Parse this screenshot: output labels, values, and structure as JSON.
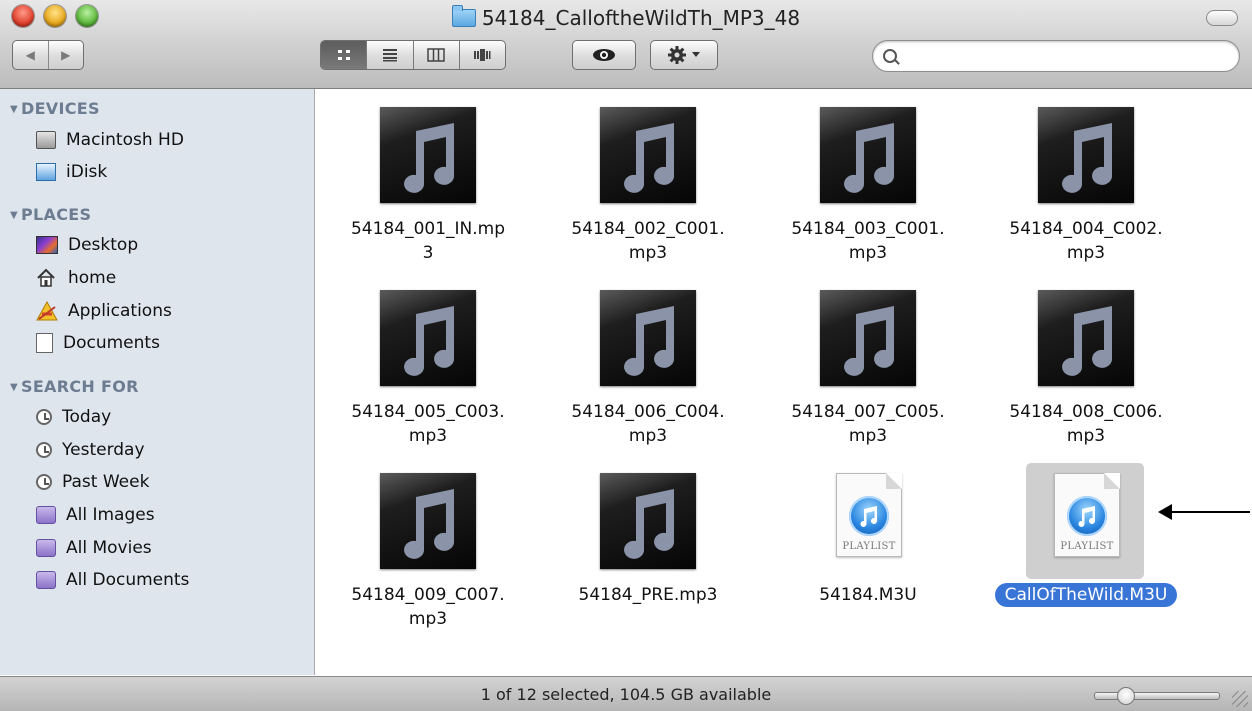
{
  "window": {
    "title": "54184_CalloftheWildTh_MP3_48"
  },
  "toolbar": {
    "back": "◀",
    "forward": "▶",
    "search_placeholder": ""
  },
  "sidebar": {
    "devices_label": "DEVICES",
    "devices": [
      {
        "label": "Macintosh HD",
        "icon": "hard-drive-icon"
      },
      {
        "label": "iDisk",
        "icon": "idisk-icon"
      }
    ],
    "places_label": "PLACES",
    "places": [
      {
        "label": "Desktop",
        "icon": "desktop-icon"
      },
      {
        "label": "home",
        "icon": "home-icon"
      },
      {
        "label": "Applications",
        "icon": "applications-icon"
      },
      {
        "label": "Documents",
        "icon": "documents-icon"
      }
    ],
    "search_label": "SEARCH FOR",
    "search_for": [
      {
        "label": "Today",
        "icon": "clock-icon"
      },
      {
        "label": "Yesterday",
        "icon": "clock-icon"
      },
      {
        "label": "Past Week",
        "icon": "clock-icon"
      },
      {
        "label": "All Images",
        "icon": "smart-folder-icon"
      },
      {
        "label": "All Movies",
        "icon": "smart-folder-icon"
      },
      {
        "label": "All Documents",
        "icon": "smart-folder-icon"
      }
    ]
  },
  "files": [
    {
      "line1": "54184_001_IN.mp",
      "line2": "3",
      "kind": "mp3"
    },
    {
      "line1": "54184_002_C001.",
      "line2": "mp3",
      "kind": "mp3"
    },
    {
      "line1": "54184_003_C001.",
      "line2": "mp3",
      "kind": "mp3"
    },
    {
      "line1": "54184_004_C002.",
      "line2": "mp3",
      "kind": "mp3"
    },
    {
      "line1": "54184_005_C003.",
      "line2": "mp3",
      "kind": "mp3"
    },
    {
      "line1": "54184_006_C004.",
      "line2": "mp3",
      "kind": "mp3"
    },
    {
      "line1": "54184_007_C005.",
      "line2": "mp3",
      "kind": "mp3"
    },
    {
      "line1": "54184_008_C006.",
      "line2": "mp3",
      "kind": "mp3"
    },
    {
      "line1": "54184_009_C007.",
      "line2": "mp3",
      "kind": "mp3"
    },
    {
      "line1": "54184_PRE.mp3",
      "line2": "",
      "kind": "mp3"
    },
    {
      "line1": "54184.M3U",
      "line2": "",
      "kind": "playlist"
    },
    {
      "line1": "CallOfTheWild.M3U",
      "line2": "",
      "kind": "playlist",
      "selected": true
    }
  ],
  "playlist_badge": "PLAYLIST",
  "status": {
    "text": "1 of 12 selected, 104.5 GB available"
  },
  "colors": {
    "selection": "#3875d7",
    "sidebar_bg": "#dfe5ed",
    "section_header": "#6d7d91"
  }
}
